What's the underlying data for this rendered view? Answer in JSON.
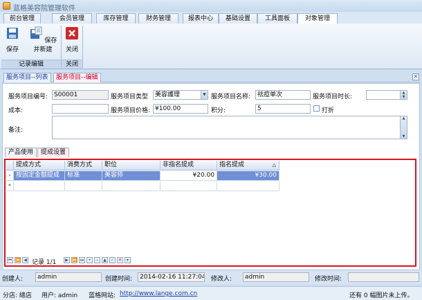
{
  "window": {
    "title": "蓝格美容院管理软件"
  },
  "menu": {
    "tabs": [
      "前台管理",
      "会员管理",
      "库存管理",
      "财务管理",
      "报表中心",
      "基础设置",
      "工具面板",
      "对象管理"
    ],
    "active": 7
  },
  "ribbon": {
    "save_label": "保存",
    "save_new_label": "保存并新建",
    "close_label": "关闭",
    "group_edit_label": "记录编辑",
    "group_close_label": "关闭"
  },
  "doc_tabs": [
    "服务项目--列表",
    "服务项目--编辑"
  ],
  "form": {
    "code_label": "服务项目编号:",
    "code_value": "S00001",
    "type_label": "服务项目类型",
    "type_value": "美容護理",
    "name_label": "服务项目名称:",
    "name_value": "祛痘单次",
    "duration_label": "服务项目时长:",
    "duration_value": "",
    "cost_label": "成本:",
    "cost_value": "",
    "price_label": "服务项目价格:",
    "price_value": "¥100.00",
    "points_label": "积分:",
    "points_value": "5",
    "discount_label": "打折",
    "remark_label": "备注:"
  },
  "sub_tabs": [
    "产品使用",
    "提成设置"
  ],
  "grid": {
    "columns": [
      "提成方式",
      "消费方式",
      "职位",
      "非指名提成",
      "指名提成"
    ],
    "rows": [
      [
        "按固定金额提成",
        "标准",
        "美容师",
        "¥20.00",
        "¥30.00"
      ]
    ],
    "nav_record": "记录 1/1"
  },
  "footer": {
    "creator_label": "创建人:",
    "creator_value": "admin",
    "created_label": "创建时间:",
    "created_value": "2014-02-16 11:27:04",
    "modifier_label": "修改人:",
    "modifier_value": "admin",
    "modified_label": "修改时间:",
    "modified_value": ""
  },
  "status": {
    "store": "分店: 總店",
    "user": "用户: admin",
    "site_label": "蓝格网站:",
    "site_url": "http://www.lange.com.cn",
    "upload": "还有 0 幅图片未上传。"
  },
  "colors": {
    "accent": "#d9141f",
    "selection": "#6f8fd6",
    "ribbon": "#dde8f5"
  }
}
